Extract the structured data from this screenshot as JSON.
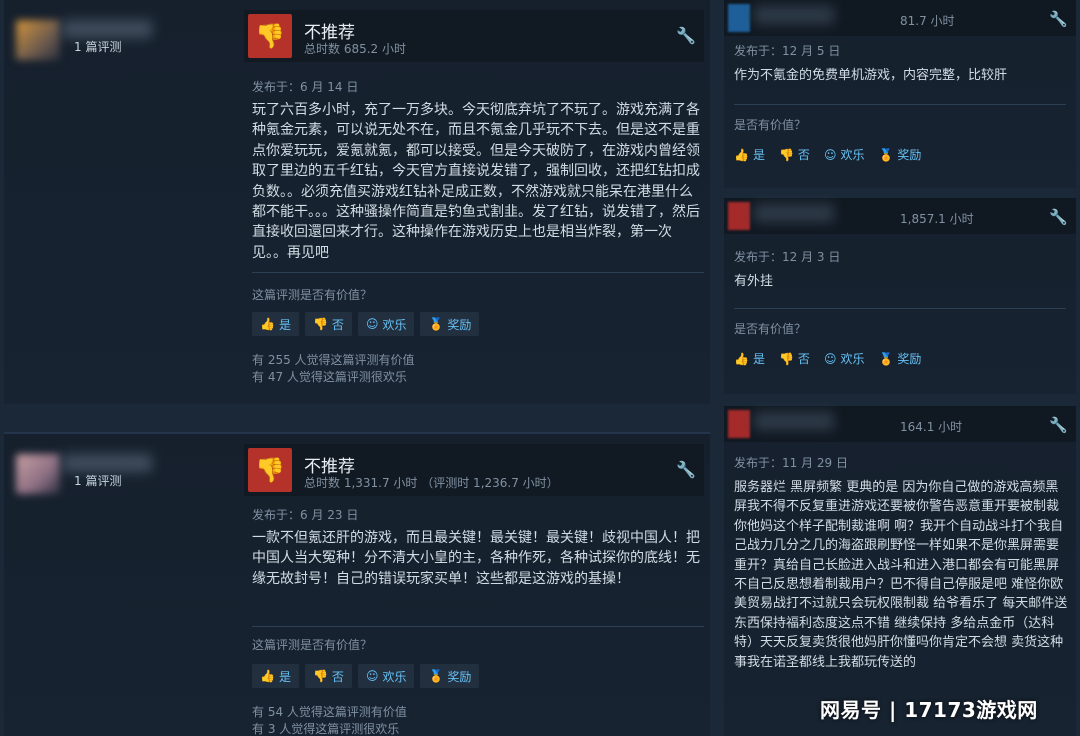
{
  "review_1": {
    "author_stat": "1 篇评测",
    "recommendation": "不推荐",
    "hours": "总时数 685.2 小时",
    "posted": "发布于：6 月 14 日",
    "body": "玩了六百多小时，充了一万多块。今天彻底弃坑了不玩了。游戏充满了各种氪金元素，可以说无处不在，而且不氪金几乎玩不下去。但是这不是重点你爱玩玩，爱氪就氪，都可以接受。但是今天破防了，在游戏内曾经领取了里边的五千红钻，今天官方直接说发错了，强制回收，还把红钻扣成负数。。必须充值买游戏红钻补足成正数，不然游戏就只能呆在港里什么都不能干。。。这种骚操作简直是钓鱼式割韭。发了红钻，说发错了，然后直接收回還回来才行。这种操作在游戏历史上也是相当炸裂，第一次见。。再见吧",
    "helpful_q": "这篇评测是否有价值？",
    "btn_yes": "是",
    "btn_no": "否",
    "btn_funny": "欢乐",
    "btn_award": "奖励",
    "votes_helpful": "有 255 人觉得这篇评测有价值",
    "votes_funny": "有 47 人觉得这篇评测很欢乐"
  },
  "review_2": {
    "author_stat": "1 篇评测",
    "recommendation": "不推荐",
    "hours": "总时数 1,331.7 小时 （评测时 1,236.7 小时）",
    "posted": "发布于：6 月 23 日",
    "body": "一款不但氪还肝的游戏，而且最关键！最关键！最关键！歧视中国人！把中国人当大冤种！分不清大小皇的主，各种作死，各种试探你的底线！无缘无故封号！自己的错误玩家买单！这些都是这游戏的基操！",
    "helpful_q": "这篇评测是否有价值？",
    "btn_yes": "是",
    "btn_no": "否",
    "btn_funny": "欢乐",
    "btn_award": "奖励",
    "votes_helpful": "有 54 人觉得这篇评测有价值",
    "votes_funny": "有 3 人觉得这篇评测很欢乐"
  },
  "side_1": {
    "hours": "81.7 小时",
    "posted": "发布于：12 月 5 日",
    "body": "作为不氪金的免费单机游戏，内容完整，比较肝",
    "helpful_q": "是否有价值？",
    "btn_yes": "是",
    "btn_no": "否",
    "btn_funny": "欢乐",
    "btn_award": "奖励"
  },
  "side_2": {
    "hours": "1,857.1 小时",
    "posted": "发布于：12 月 3 日",
    "body": "有外挂",
    "helpful_q": "是否有价值？",
    "btn_yes": "是",
    "btn_no": "否",
    "btn_funny": "欢乐",
    "btn_award": "奖励"
  },
  "side_3": {
    "hours": "164.1 小时",
    "posted": "发布于：11 月 29 日",
    "body": "服务器烂 黑屏频繁 更典的是 因为你自己做的游戏高频黑屏我不得不反复重进游戏还要被你警告恶意重开要被制裁 你他妈这个样子配制裁谁啊 啊？我开个自动战斗打个我自己战力几分之几的海盗跟刷野怪一样如果不是你黑屏需要重开？真给自己长脸进入战斗和进入港口都会有可能黑屏 不自己反思想着制裁用户？巴不得自己停服是吧 难怪你欧美贸易战打不过就只会玩权限制裁 给爷看乐了 每天邮件送东西保持福利态度这点不错 继续保持 多给点金币（达科特）天天反复卖货很他妈肝你懂吗你肯定不会想 卖货这种事我在诺圣都线上我都玩传送的"
  },
  "watermark": "网易号 | 17173游戏网",
  "icons": {
    "thumb_down": "thumbs-down-icon",
    "wrench": "wrench-icon",
    "award": "award-icon"
  }
}
